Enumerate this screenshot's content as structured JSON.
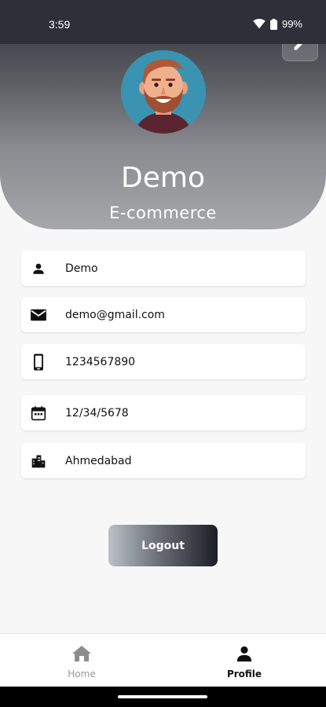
{
  "status_bar": {
    "time": "3:59",
    "battery": "99%",
    "icons": [
      "wifi-icon",
      "battery-icon"
    ]
  },
  "profile": {
    "name": "Demo",
    "subtitle": "E-commerce",
    "avatar": "avatar-illustration",
    "edit_icon": "pencil-icon"
  },
  "fields": [
    {
      "icon": "person-icon",
      "value": "Demo"
    },
    {
      "icon": "mail-icon",
      "value": "demo@gmail.com"
    },
    {
      "icon": "phone-icon",
      "value": "1234567890"
    },
    {
      "icon": "calendar-icon",
      "value": "12/34/5678"
    },
    {
      "icon": "city-icon",
      "value": "Ahmedabad"
    }
  ],
  "logout_label": "Logout",
  "bottom_nav": {
    "items": [
      {
        "label": "Home",
        "icon": "home-icon",
        "active": false
      },
      {
        "label": "Profile",
        "icon": "person-icon",
        "active": true
      }
    ]
  },
  "colors": {
    "header_top": "#2e3038",
    "header_bottom": "#a6a7ab",
    "logout_start": "#b9c1c9",
    "logout_end": "#1c1d26",
    "background": "#f7f7f7"
  }
}
